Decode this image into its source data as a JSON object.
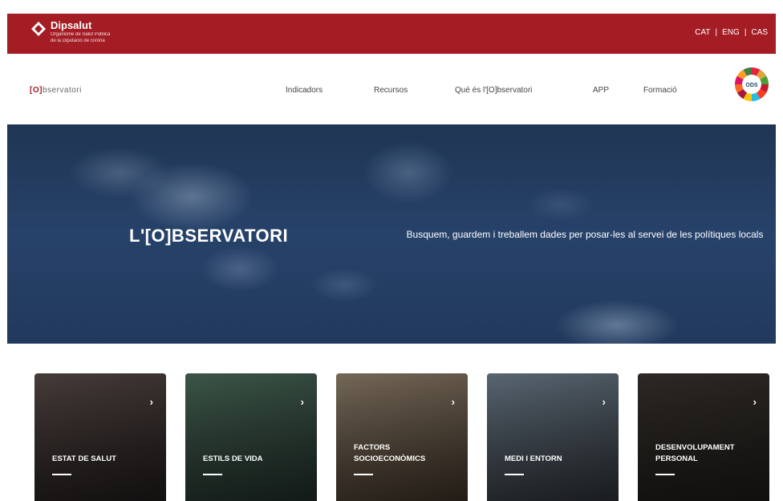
{
  "header": {
    "brand_name": "Dipsalut",
    "brand_subtitle_line1": "Organisme de Salut Pública",
    "brand_subtitle_line2": "de la Diputació de Girona",
    "languages": [
      "CAT",
      "|",
      "ENG",
      "|",
      "CAS"
    ]
  },
  "nav": {
    "site_logo_prefix": "[O]",
    "site_logo_suffix": "bservatori",
    "items": [
      {
        "label": "Indicadors"
      },
      {
        "label": "Recursos"
      },
      {
        "label": "Què és l'[O]bservatori"
      },
      {
        "label": "APP"
      },
      {
        "label": "Formació"
      }
    ],
    "ods_label": "ODS"
  },
  "hero": {
    "title": "L'[O]BSERVATORI",
    "tagline": "Busquem, guardem i treballem dades per posar-les al servei de les polítiques locals"
  },
  "cards": [
    {
      "label_line1": "ESTAT DE SALUT",
      "label_line2": "",
      "arrow": "›",
      "color_top": "#4a3f3c",
      "color_bottom": "#1e1a1a"
    },
    {
      "label_line1": "ESTILS DE VIDA",
      "label_line2": "",
      "arrow": "›",
      "color_top": "#3f5a4b",
      "color_bottom": "#1f2b27"
    },
    {
      "label_line1": "FACTORS",
      "label_line2": "SOCIOECONÒMICS",
      "arrow": "›",
      "color_top": "#7a6d5c",
      "color_bottom": "#3a2f25"
    },
    {
      "label_line1": "MEDI I ENTORN",
      "label_line2": "",
      "arrow": "›",
      "color_top": "#5d6b78",
      "color_bottom": "#2b2f33"
    },
    {
      "label_line1": "DESENVOLUPAMENT",
      "label_line2": "PERSONAL",
      "arrow": "›",
      "color_top": "#2f2a25",
      "color_bottom": "#1b1917"
    }
  ]
}
